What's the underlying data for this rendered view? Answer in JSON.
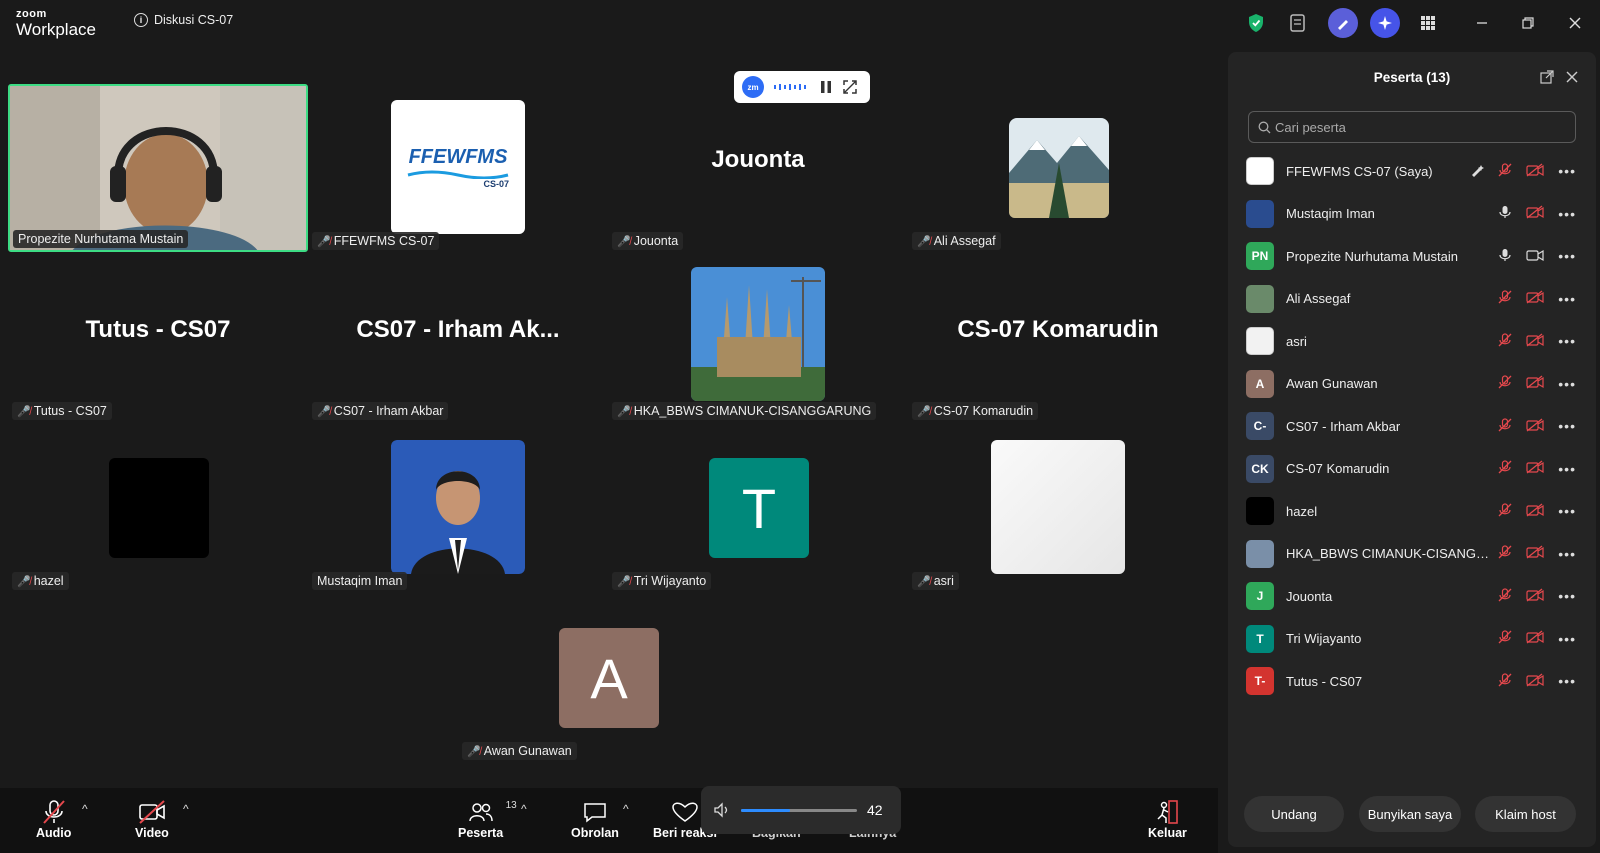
{
  "app": {
    "brand_small": "zoom",
    "brand": "Workplace",
    "meeting_title": "Diskusi CS-07"
  },
  "gallery": {
    "tiles": [
      {
        "name": "Propezite Nurhutama Mustain",
        "muted": false,
        "kind": "video"
      },
      {
        "name": "FFEWFMS CS-07",
        "muted": true,
        "kind": "logo",
        "logo_text": "FFEWFMS",
        "logo_sub": "CS-07"
      },
      {
        "name": "Jouonta",
        "muted": true,
        "kind": "text",
        "big": "Jouonta"
      },
      {
        "name": "Ali Assegaf",
        "muted": true,
        "kind": "image"
      },
      {
        "name": "Tutus - CS07",
        "muted": true,
        "kind": "text",
        "big": "Tutus - CS07"
      },
      {
        "name": "CS07 - Irham Akbar",
        "muted": true,
        "kind": "text",
        "big": "CS07 - Irham Ak..."
      },
      {
        "name": "HKA_BBWS CIMANUK-CISANGGARUNG",
        "muted": true,
        "kind": "image"
      },
      {
        "name": "CS-07 Komarudin",
        "muted": true,
        "kind": "text",
        "big": "CS-07 Komarudin"
      },
      {
        "name": "hazel",
        "muted": true,
        "kind": "image"
      },
      {
        "name": "Mustaqim Iman",
        "muted": false,
        "kind": "image"
      },
      {
        "name": "Tri Wijayanto",
        "muted": true,
        "kind": "letter",
        "letter": "T"
      },
      {
        "name": "asri",
        "muted": true,
        "kind": "image"
      },
      {
        "name": "Awan Gunawan",
        "muted": true,
        "kind": "letter",
        "letter": "A"
      }
    ]
  },
  "recording": {
    "badge": "zm"
  },
  "panel": {
    "title": "Peserta (13)",
    "search_placeholder": "Cari peserta",
    "participants": [
      {
        "name": "FFEWFMS CS-07 (Saya)",
        "avatar": "",
        "color": "#ffffff",
        "mic": "muted",
        "video": "off"
      },
      {
        "name": "Mustaqim Iman",
        "avatar": "",
        "color": "#2a4c8f",
        "mic": "on",
        "video": "off"
      },
      {
        "name": "Propezite Nurhutama Mustain",
        "avatar": "PN",
        "color": "#2fa85a",
        "mic": "on",
        "video": "on"
      },
      {
        "name": "Ali Assegaf",
        "avatar": "",
        "color": "#6a8a6a",
        "mic": "muted",
        "video": "off"
      },
      {
        "name": "asri",
        "avatar": "",
        "color": "#f2f2f2",
        "mic": "muted",
        "video": "off"
      },
      {
        "name": "Awan Gunawan",
        "avatar": "A",
        "color": "#8d6e63",
        "mic": "muted",
        "video": "off"
      },
      {
        "name": "CS07 - Irham Akbar",
        "avatar": "C-",
        "color": "#3a4a66",
        "mic": "muted",
        "video": "off"
      },
      {
        "name": "CS-07 Komarudin",
        "avatar": "CK",
        "color": "#3a4a66",
        "mic": "muted",
        "video": "off"
      },
      {
        "name": "hazel",
        "avatar": "",
        "color": "#000000",
        "mic": "muted",
        "video": "off"
      },
      {
        "name": "HKA_BBWS CIMANUK-CISANGGA...",
        "avatar": "",
        "color": "#7a8fa8",
        "mic": "muted",
        "video": "off"
      },
      {
        "name": "Jouonta",
        "avatar": "J",
        "color": "#2fa85a",
        "mic": "muted",
        "video": "off"
      },
      {
        "name": "Tri Wijayanto",
        "avatar": "T",
        "color": "#00897b",
        "mic": "muted",
        "video": "off"
      },
      {
        "name": "Tutus - CS07",
        "avatar": "T-",
        "color": "#d3342f",
        "mic": "muted",
        "video": "off"
      }
    ],
    "buttons": {
      "invite": "Undang",
      "unmute_me": "Bunyikan saya",
      "claim_host": "Klaim host"
    }
  },
  "toolbar": {
    "audio": "Audio",
    "video": "Video",
    "participants": "Peserta",
    "participants_count": "13",
    "chat": "Obrolan",
    "react": "Beri reaksi",
    "share": "Bagikan",
    "more": "Lainnya",
    "leave": "Keluar"
  },
  "volume": {
    "level": 42,
    "fraction": 0.42
  },
  "colors": {
    "active_speaker": "#3ddc84",
    "muted_red": "#e5484d",
    "accent": "#2d8cff"
  }
}
